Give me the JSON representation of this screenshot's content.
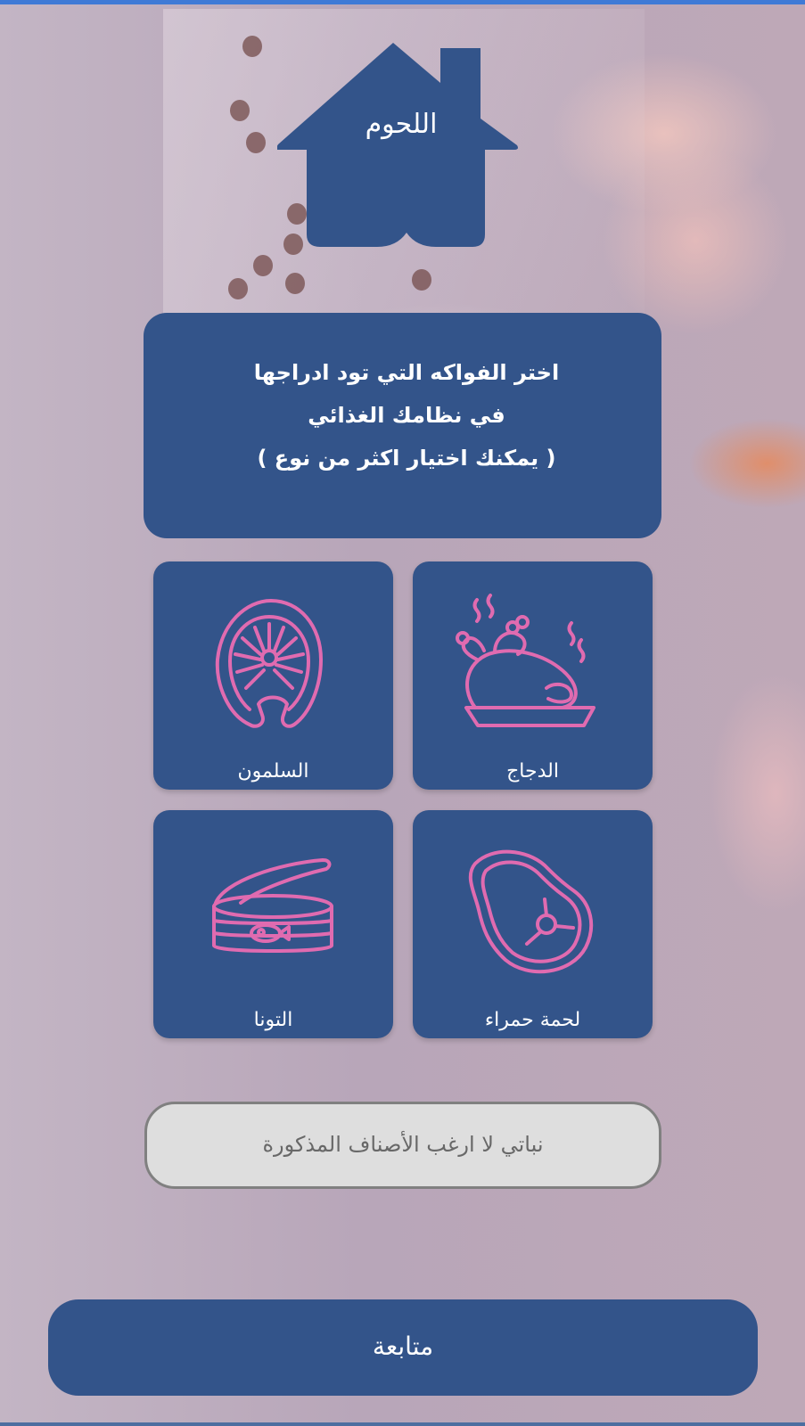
{
  "header": {
    "title": "اللحوم"
  },
  "instructions": {
    "line1": "اختر الفواكه التي تود ادراجها",
    "line2": "في نظامك الغذائي",
    "line3": "( يمكنك اختيار اكثر من نوع )"
  },
  "options": [
    {
      "label": "الدجاج",
      "icon": "roast-chicken-icon"
    },
    {
      "label": "السلمون",
      "icon": "salmon-steak-icon"
    },
    {
      "label": "لحمة حمراء",
      "icon": "steak-icon"
    },
    {
      "label": "التونا",
      "icon": "tuna-can-icon"
    }
  ],
  "vegetarian_option": {
    "label": "نباتي لا ارغب الأصناف المذكورة"
  },
  "continue_button": {
    "label": "متابعة"
  },
  "colors": {
    "primary": "#33548a",
    "icon_accent": "#e06bb0",
    "background": "#b8a6b8"
  }
}
